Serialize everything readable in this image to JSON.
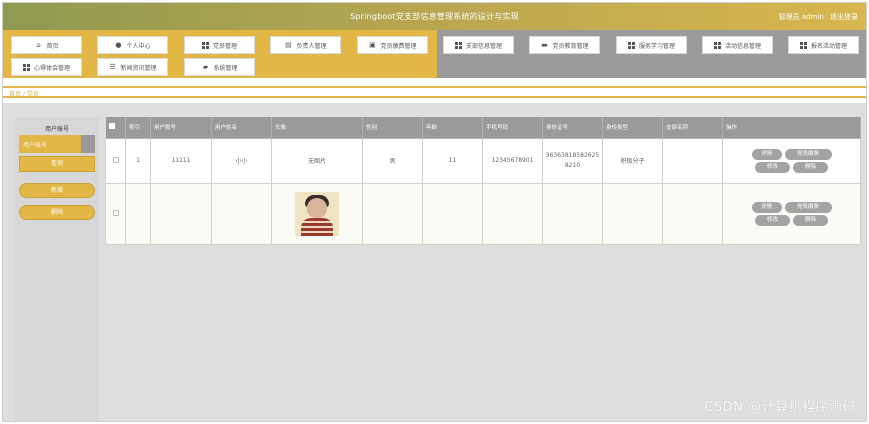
{
  "header": {
    "title": "Springboot党支部信息管理系统的设计与实现",
    "user_label": "管理员 admin",
    "logout": "退出登录"
  },
  "nav": {
    "row1": [
      {
        "label": "首页",
        "icon": "home-icon"
      },
      {
        "label": "个人中心",
        "icon": "person-icon"
      },
      {
        "label": "党员管理",
        "icon": "grid-icon"
      },
      {
        "label": "负责人管理",
        "icon": "document-icon"
      },
      {
        "label": "党员缴费管理",
        "icon": "briefcase-icon"
      },
      {
        "label": "支部信息管理",
        "icon": "grid-icon"
      },
      {
        "label": "党员教育管理",
        "icon": "monitor-icon"
      },
      {
        "label": "服务学习管理",
        "icon": "grid-icon"
      },
      {
        "label": "活动信息管理",
        "icon": "grid-icon"
      },
      {
        "label": "报名活动管理",
        "icon": "grid-icon"
      }
    ],
    "row2": [
      {
        "label": "心得体会管理",
        "icon": "grid-icon"
      },
      {
        "label": "新闻资讯管理",
        "icon": "list-icon"
      },
      {
        "label": "系统管理",
        "icon": "chat-icon"
      }
    ]
  },
  "breadcrumb": {
    "home": "首页",
    "sep": "/",
    "current": "党员"
  },
  "sidebar": {
    "field_label": "用户账号",
    "search_placeholder": "用户账号",
    "query_button": "查询",
    "add_button": "新增",
    "delete_button": "删除"
  },
  "table": {
    "headers": [
      "",
      "索引",
      "用户账号",
      "用户姓名",
      "头像",
      "性别",
      "年龄",
      "手机号码",
      "身份证号",
      "身份类型",
      "支部名称",
      "操作"
    ],
    "rows": [
      {
        "index": "1",
        "account": "11111",
        "name": "小小",
        "avatar": "无图片",
        "gender": "男",
        "age": "11",
        "phone": "12345678901",
        "id_card": "363638185826258210",
        "type": "积极分子",
        "branch": ""
      },
      {
        "index": "",
        "account": "",
        "name": "",
        "avatar": "",
        "gender": "",
        "age": "",
        "phone": "",
        "id_card": "",
        "type": "",
        "branch": ""
      }
    ],
    "actions": {
      "detail": "详情",
      "pay": "党员缴费",
      "edit": "修改",
      "delete": "删除"
    }
  },
  "watermark": "CSDN @计算机程序源码",
  "colors": {
    "accent": "#e2b745",
    "gray": "#9b9b9b",
    "header_start": "#8f9a50"
  }
}
